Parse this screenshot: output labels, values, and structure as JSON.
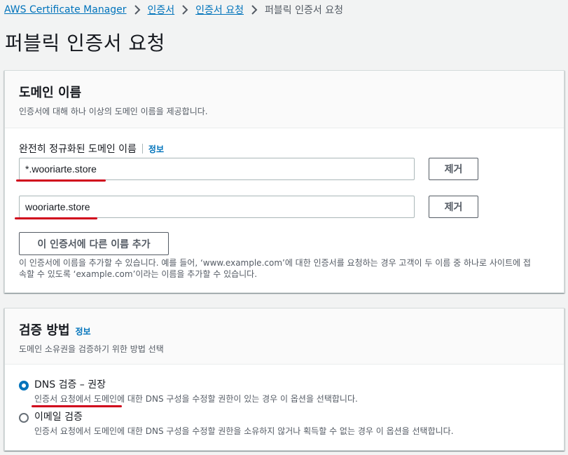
{
  "breadcrumb": {
    "items": [
      "AWS Certificate Manager",
      "인증서",
      "인증서 요청"
    ],
    "current": "퍼블릭 인증서 요청"
  },
  "page": {
    "title": "퍼블릭 인증서 요청"
  },
  "domain_panel": {
    "title": "도메인 이름",
    "description": "인증서에 대해 하나 이상의 도메인 이름을 제공합니다.",
    "field_label": "완전히 정규화된 도메인 이름",
    "info": "정보",
    "domains": [
      "*.wooriarte.store",
      "wooriarte.store"
    ],
    "remove_label": "제거",
    "add_button": "이 인증서에 다른 이름 추가",
    "helper_line1": "이 인증서에 이름을 추가할 수 있습니다. 예를 들어, ‘www.example.com’에 대한 인증서를 요청하는 경우 고객이 두 이름 중 하나로 사이트에 접",
    "helper_line2": "속할 수 있도록 ‘example.com’이라는 이름을 추가할 수 있습니다."
  },
  "validation_panel": {
    "title": "검증 방법",
    "info": "정보",
    "description": "도메인 소유권을 검증하기 위한 방법 선택",
    "options": [
      {
        "label": "DNS 검증 – 권장",
        "description": "인증서 요청에서 도메인에 대한 DNS 구성을 수정할 권한이 있는 경우 이 옵션을 선택합니다.",
        "selected": true
      },
      {
        "label": "이메일 검증",
        "description": "인증서 요청에서 도메인에 대한 DNS 구성을 수정할 권한을 소유하지 않거나 획득할 수 없는 경우 이 옵션을 선택합니다.",
        "selected": false
      }
    ]
  },
  "colors": {
    "link": "#0073bb",
    "annotation": "#d0021b",
    "radio_selected": "#0073bb"
  },
  "icons": {
    "breadcrumb_separator": "chevron-right-icon"
  }
}
